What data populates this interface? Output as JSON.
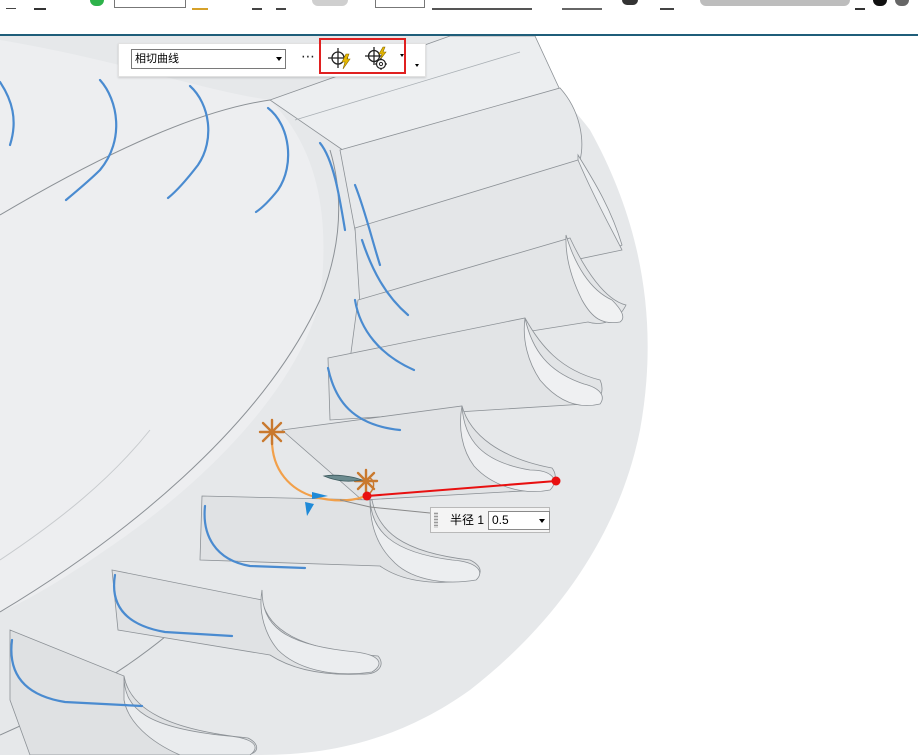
{
  "toolbar": {
    "field_a_value": "",
    "field_b_value": ""
  },
  "mini_toolbar": {
    "curve_type": "相切曲线",
    "more_label": "⋯",
    "icons": [
      "crosshair-lightning-icon",
      "crosshair-gear-lightning-icon"
    ]
  },
  "radius_input": {
    "label": "半径 1",
    "value": "0.5"
  },
  "colors": {
    "model_surface": "#e6e8ea",
    "edge_line": "#8c9196",
    "blue_curve": "#4a8bd0",
    "orange_curve": "#f2a04a",
    "anchor_orange": "#c9792e",
    "red_line": "#e81010",
    "highlight_red": "#e02020",
    "arrow_blue": "#1f8ad8"
  }
}
